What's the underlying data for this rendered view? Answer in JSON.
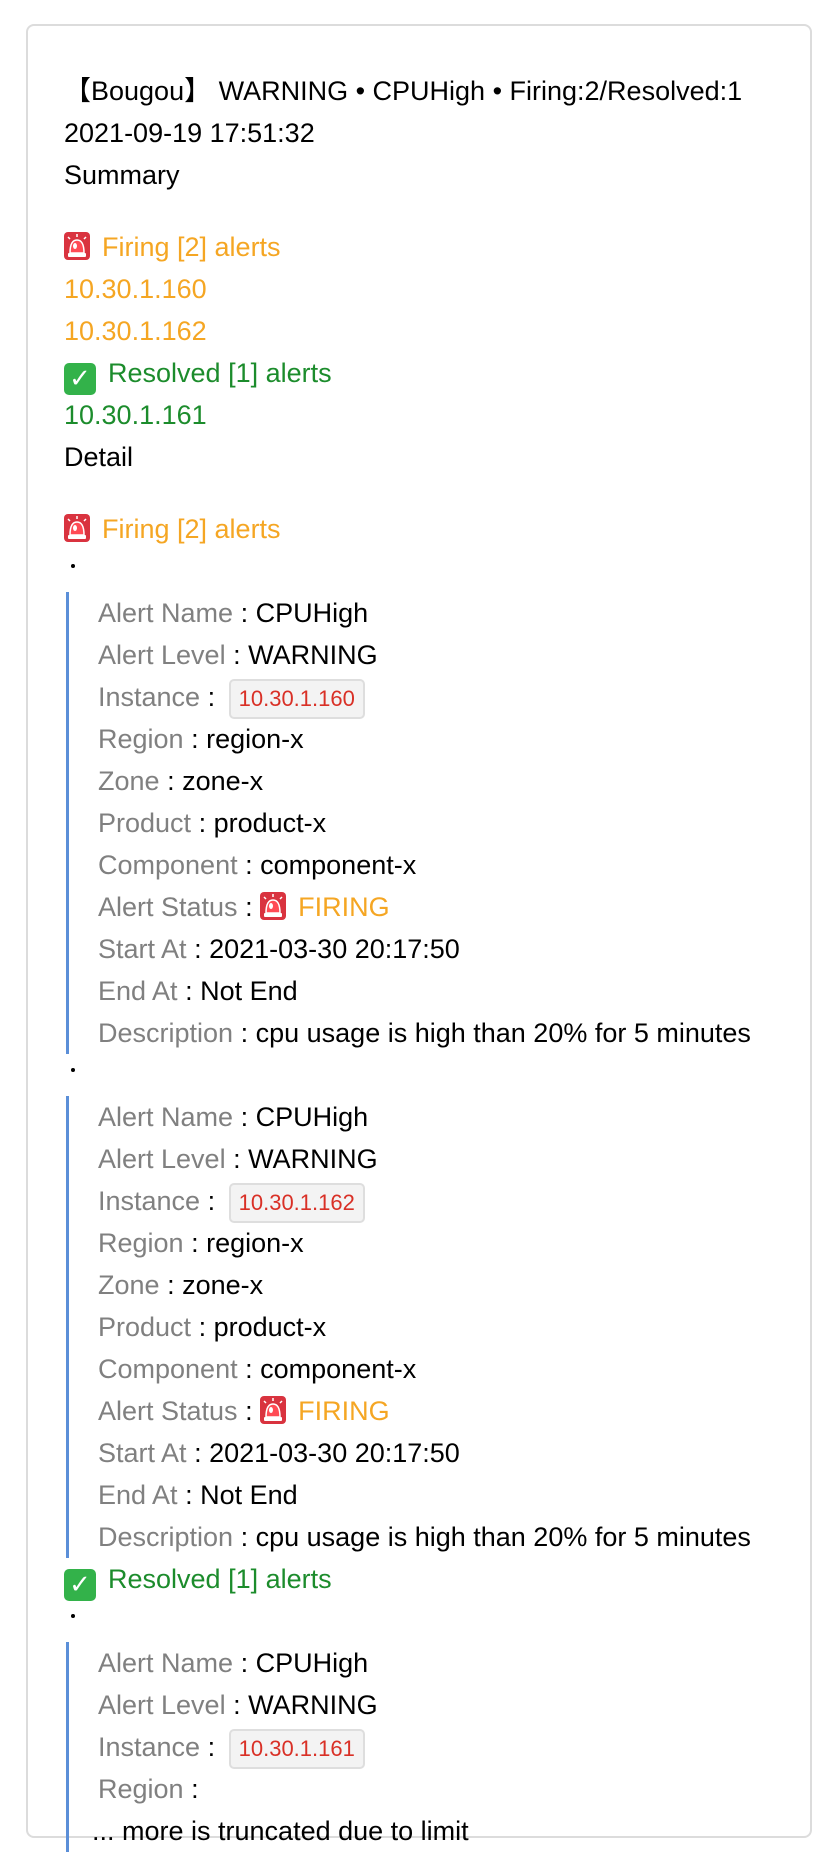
{
  "header": {
    "title": "【Bougou】 WARNING • CPUHigh • Firing:2/Resolved:1",
    "timestamp": "2021-09-19 17:51:32",
    "summary_label": "Summary"
  },
  "summary": {
    "firing_heading": "Firing [2] alerts",
    "firing_instances": [
      "10.30.1.160",
      "10.30.1.162"
    ],
    "resolved_heading": "Resolved [1] alerts",
    "resolved_instances": [
      "10.30.1.161"
    ]
  },
  "detail_label": "Detail",
  "labels": {
    "alert_name": "Alert Name",
    "alert_level": "Alert Level",
    "instance": "Instance",
    "region": "Region",
    "zone": "Zone",
    "product": "Product",
    "component": "Component",
    "alert_status": "Alert Status",
    "start_at": "Start At",
    "end_at": "End At",
    "description": "Description",
    "separator": ":"
  },
  "detail_firing": {
    "heading": "Firing [2] alerts",
    "alerts": [
      {
        "alert_name": "CPUHigh",
        "alert_level": "WARNING",
        "instance": "10.30.1.160",
        "region": "region-x",
        "zone": "zone-x",
        "product": "product-x",
        "component": "component-x",
        "status": "FIRING",
        "start_at": "2021-03-30 20:17:50",
        "end_at": "Not End",
        "description": "cpu usage is high than 20% for 5 minutes"
      },
      {
        "alert_name": "CPUHigh",
        "alert_level": "WARNING",
        "instance": "10.30.1.162",
        "region": "region-x",
        "zone": "zone-x",
        "product": "product-x",
        "component": "component-x",
        "status": "FIRING",
        "start_at": "2021-03-30 20:17:50",
        "end_at": "Not End",
        "description": "cpu usage is high than 20% for 5 minutes"
      }
    ]
  },
  "detail_resolved": {
    "heading": "Resolved [1] alerts",
    "alerts": [
      {
        "alert_name": "CPUHigh",
        "alert_level": "WARNING",
        "instance": "10.30.1.161",
        "region": ""
      }
    ]
  },
  "truncated_note": "... more is truncated due to limit",
  "icons": {
    "firing": "siren-icon",
    "resolved": "check-mark-icon",
    "bullet": "bullet-icon"
  },
  "colors": {
    "firing": "#f5a623",
    "resolved": "#1c8c2c",
    "label": "#808080",
    "instance_code": "#d93026",
    "quote_border": "#5b8fd8"
  }
}
